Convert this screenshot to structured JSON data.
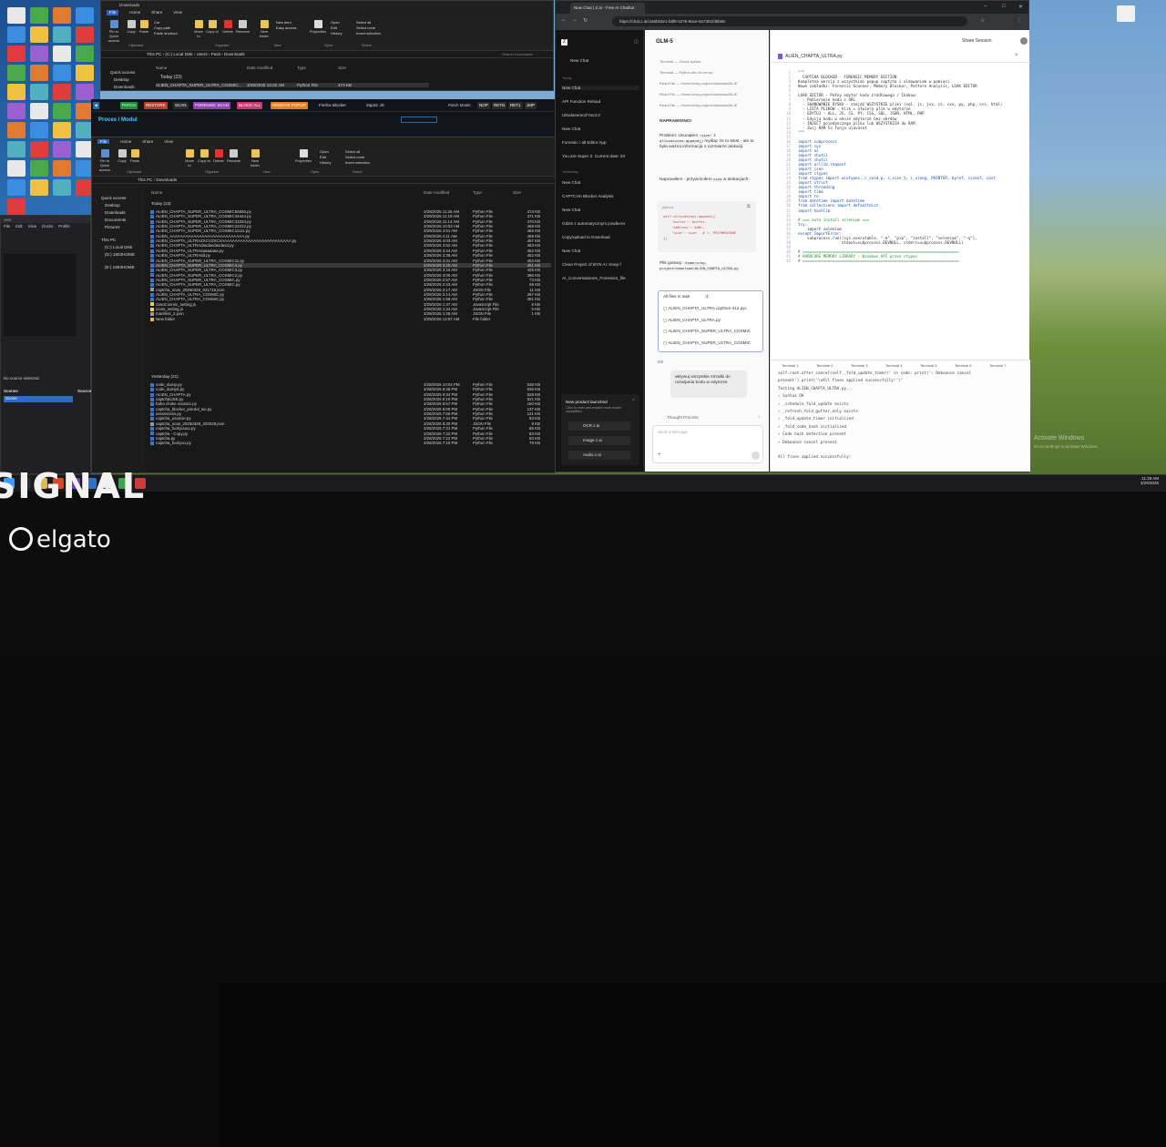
{
  "explorer_back": {
    "title": "Downloads",
    "tabs": [
      "File",
      "Home",
      "Share",
      "View"
    ],
    "ribbon": [
      "Pin to Quick access",
      "Copy",
      "Paste",
      "Cut",
      "Copy path",
      "Paste shortcut",
      "Move to",
      "Copy to",
      "Delete",
      "Rename",
      "New folder",
      "New item",
      "Easy access",
      "Properties",
      "Open",
      "Edit",
      "History",
      "Select all",
      "Select none",
      "Invert selection"
    ],
    "ribbon_groups": [
      "Clipboard",
      "Organize",
      "New",
      "Open",
      "Select"
    ],
    "path": "This PC › (C:) Local Disk › Users › Pasit › Downloads",
    "search": "Search Downloads",
    "columns": [
      "Name",
      "Date modified",
      "Type",
      "Size"
    ],
    "group": "Today (23)",
    "row1": {
      "name": "ALIEN_CHAPTA_SUPER_ULTRA_COSMIC...",
      "date": "3/29/2026 13:20 AM",
      "type": "Python File",
      "size": "473 KB"
    },
    "nav": [
      "Quick access",
      "Desktop",
      "Downloads"
    ]
  },
  "app_toolbar": {
    "buttons": [
      "PATCH",
      "RESTORE",
      "SCAN",
      "FORENSIC SCAN",
      "BLOCK ALL",
      "REMOVE POPUP"
    ],
    "extra": [
      "Firefox Blocker",
      "Zapisz JS"
    ],
    "patch_mode": "Patch Mode:",
    "modes": [
      "NOP",
      "RETN",
      "RET1",
      "JMP"
    ],
    "panel_title": "Proces / Modul"
  },
  "explorer_front": {
    "tabs": [
      "File",
      "Home",
      "Share",
      "View"
    ],
    "ribbon_groups": [
      "Clipboard",
      "Organize",
      "New",
      "Open",
      "Select"
    ],
    "path": "This PC › Downloads",
    "columns": [
      "Name",
      "Date modified",
      "Type",
      "Size"
    ],
    "group_today": "Today (23)",
    "group_yesterday": "Yesterday (21)",
    "nav": [
      "Quick access",
      "Desktop",
      "Downloads",
      "Documents",
      "Pictures",
      "This PC",
      "(C:) Local Disk",
      "(D:) 1803HOME",
      "(E:) 1903HOME"
    ],
    "today_files": [
      {
        "n": "ALIEN_CHAPTA_SUPER_ULTRA_COSMIC55555.py",
        "d": "3/29/2026 11:26 AM",
        "t": "Python File",
        "s": "474 KB"
      },
      {
        "n": "ALIEN_CHAPTA_SUPER_ULTRA_COSMIC44444.py",
        "d": "3/29/2026 11:19 AM",
        "t": "Python File",
        "s": "471 KB"
      },
      {
        "n": "ALIEN_CHAPTA_SUPER_ULTRA_COSMIC33333.py",
        "d": "3/29/2026 11:14 AM",
        "t": "Python File",
        "s": "470 KB"
      },
      {
        "n": "ALIEN_CHAPTA_SUPER_ULTRA_COSMIC22222.py",
        "d": "3/29/2026 10:53 AM",
        "t": "Python File",
        "s": "469 KB"
      },
      {
        "n": "ALIEN_CHAPTA_SUPER_ULTRA_COSMIC11111.py",
        "d": "3/29/2026 4:51 AM",
        "t": "Python File",
        "s": "465 KB"
      },
      {
        "n": "ALIEN_AAAAAAAAAAAAAAAAAAAAAAAAAAAA.py",
        "d": "3/29/2026 4:11 AM",
        "t": "Python File",
        "s": "459 KB"
      },
      {
        "n": "ALIEN_CHAPTA_ULTRAZXCVZXCVAAAAAAAAAAAAAAAAAAAAAAAAAA.py",
        "d": "3/29/2026 4:03 AM",
        "t": "Python File",
        "s": "457 KB"
      },
      {
        "n": "ALIEN_CHAPTA_ULTRAdasdasdasdasd.py",
        "d": "3/29/2026 3:52 AM",
        "t": "Python File",
        "s": "453 KB"
      },
      {
        "n": "ALIEN_CHAPTA_ULTRAaaaaaaaa.py",
        "d": "3/29/2026 3:44 AM",
        "t": "Python File",
        "s": "452 KB"
      },
      {
        "n": "ALIEN_CHAPTA_ULTRAdd.py",
        "d": "3/29/2026 3:38 AM",
        "t": "Python File",
        "s": "452 KB"
      },
      {
        "n": "ALIEN_CHAPTA_SUPER_ULTRA_COSMIC11.py",
        "d": "3/29/2026 3:31 AM",
        "t": "Python File",
        "s": "453 KB"
      },
      {
        "n": "ALIEN_CHAPTA_SUPER_ULTRA_COSMIC4.py",
        "d": "3/29/2026 3:25 AM",
        "t": "Python File",
        "s": "451 KB"
      },
      {
        "n": "ALIEN_CHAPTA_SUPER_ULTRA_COSMIC3.py",
        "d": "3/29/2026 3:16 AM",
        "t": "Python File",
        "s": "425 KB"
      },
      {
        "n": "ALIEN_CHAPTA_SUPER_ULTRA_COSMIC2.py",
        "d": "3/29/2026 3:08 AM",
        "t": "Python File",
        "s": "396 KB"
      },
      {
        "n": "ALIEN_CHAPTA_SUPER_ULTRA_COSMIC.py",
        "d": "3/29/2026 2:57 AM",
        "t": "Python File",
        "s": "73 KB"
      },
      {
        "n": "ALIEN_CHAPTA_SUPER_ULTRA_COSMIC.py",
        "d": "3/29/2026 2:43 AM",
        "t": "Python File",
        "s": "69 KB"
      },
      {
        "n": "captcha_scan_20260329_021715.json",
        "d": "3/29/2026 2:17 AM",
        "t": "JSON File",
        "s": "11 KB"
      },
      {
        "n": "ALIEN_CHAPTA_ULTRA_COSMIC.py",
        "d": "3/29/2026 2:14 AM",
        "t": "Python File",
        "s": "287 KB"
      },
      {
        "n": "ALIEN_CHAPTA_ULTRA_COSMIC.py",
        "d": "3/29/2026 1:58 AM",
        "t": "Python File",
        "s": "281 KB"
      },
      {
        "n": "zanoCosmic_setting.js",
        "d": "3/29/2026 1:37 AM",
        "t": "JavaScript File",
        "s": "6 KB"
      },
      {
        "n": "icons_setting.js",
        "d": "3/29/2026 1:34 AM",
        "t": "JavaScript File",
        "s": "5 KB"
      },
      {
        "n": "manifest_2.json",
        "d": "3/29/2026 1:28 AM",
        "t": "JSON File",
        "s": "1 KB"
      },
      {
        "n": "New folder",
        "d": "3/29/2026 12:57 AM",
        "t": "File folder",
        "s": ""
      }
    ],
    "yesterday_files": [
      {
        "n": "code_dump.py",
        "d": "3/28/2026 10:04 PM",
        "t": "Python File",
        "s": "538 KB"
      },
      {
        "n": "code_dump2.py",
        "d": "3/28/2026 9:48 PM",
        "t": "Python File",
        "s": "536 KB"
      },
      {
        "n": "ALIEN_CHAPTA.py",
        "d": "3/28/2026 9:34 PM",
        "t": "Python File",
        "s": "528 KB"
      },
      {
        "n": "captchaUSE.py",
        "d": "3/28/2026 9:19 PM",
        "t": "Python File",
        "s": "521 KB"
      },
      {
        "n": "haha choke usuniec.py",
        "d": "3/28/2026 8:57 PM",
        "t": "Python File",
        "s": "160 KB"
      },
      {
        "n": "captcha_blocker_pierdol_sie.py",
        "d": "3/28/2026 8:09 PM",
        "t": "Python File",
        "s": "137 KB"
      },
      {
        "n": "asssssssss.py",
        "d": "3/28/2026 7:58 PM",
        "t": "Python File",
        "s": "121 KB"
      },
      {
        "n": "captcha_ususcie.py",
        "d": "3/28/2026 7:44 PM",
        "t": "Python File",
        "s": "93 KB"
      },
      {
        "n": "captcha_scan_20260328_203028.json",
        "d": "3/28/2026 8:30 PM",
        "t": "JSON File",
        "s": "9 KB"
      },
      {
        "n": "captcha_fuckyouuu.py",
        "d": "3/28/2026 7:31 PM",
        "t": "Python File",
        "s": "85 KB"
      },
      {
        "n": "captcha - Copy.py",
        "d": "3/28/2026 7:22 PM",
        "t": "Python File",
        "s": "83 KB"
      },
      {
        "n": "captcha.py",
        "d": "3/28/2026 7:22 PM",
        "t": "Python File",
        "s": "83 KB"
      },
      {
        "n": "captcha_fuckyou.py",
        "d": "3/28/2026 7:18 PM",
        "t": "Python File",
        "s": "79 KB"
      }
    ]
  },
  "browser": {
    "tab": "New Chat | Z.ai - Free AI Chatbot",
    "url": "https://chat.z.ai/c/a6b53e1-b8f8-4276-9ace-6a7351bf8b65",
    "sidebar": {
      "new_chat": "New Chat",
      "today": "Today",
      "today_items": [
        "New Chat",
        "API Function Reload",
        "Ultralaserocd'Yov3.0",
        "New Chat",
        "Forensic / all Editor App",
        "You are Super Z. Current date: 20"
      ],
      "yesterday": "Yesterday",
      "yesterday_items": [
        "New Chat",
        "CAPTCHA Blocker Analysis",
        "New Chat",
        "Gdzie z automatycznym powbiera",
        "Copy/upload to Download",
        "New Chat",
        "Clean Project of BYN AI: Keep f",
        "AI_Conversationes_Forensics_file"
      ],
      "promo_title": "New product launched",
      "promo_text": "Click to enter and explore more model capabilities",
      "promo_items": [
        "OCR.z.ai",
        "Image.z.ai",
        "Audio.z.ai"
      ]
    },
    "chat": {
      "model": "GLM-5",
      "tools": [
        "Terminal — Check syntax",
        "Terminal — Python dev kit errors",
        "Read File — /home/z/my-project/download/ALIE",
        "Read File — /home/z/my-project/download/ALIE",
        "Read File — /home/z/my-project/download/ALIE"
      ],
      "fixed": "NAPRAWIONO!",
      "problem_1": "Problem: Usunąłem",
      "code_size": "'size'",
      "problem_2": "z",
      "code_alloc": "allocations.append()",
      "problem_3": "myśląc że to tekst - ale to była ważna informacja o rozmiarze alokacji.",
      "restored_1": "Naprawiłem - przywróciłem",
      "code_size2": "size",
      "restored_2": "w alokacjach:",
      "code_lang": "python",
      "code_lines": [
        "self.allocations.append({",
        "    'buffer': buffer,",
        "    'address': addr,",
        "    'size': size   # <- PRZYWRÓCONE",
        "})"
      ],
      "ready_1": "Plik gotowy:",
      "ready_path": "/home/z/my-project/download/ALIEN_CHAPTA_ULTRA.py",
      "files_label": "All files in task",
      "files_count": "4",
      "files": [
        "ALIEN_CHAPTA_ULTRA.cpython-312.pyc",
        "ALIEN_CHAPTA_ULTRA.py",
        "ALIEN_CHAPTA_SUPER_ULTRA_COSMIC",
        "ALIEN_CHAPTA_SUPER_ULTRA_COSMIC"
      ],
      "pager": "8/8",
      "user_msg": "aktywuj wszystkie strzałki do rozwijania kodu w edytorze",
      "thought": "Thought Process",
      "input_placeholder": "Send a Message"
    },
    "editor": {
      "share": "Share Session",
      "filename": "ALIEN_CHAPTA_ULTRA.py",
      "code": [
        "\"\"\"",
        "  CAPTCHA BLOCKER - FORENSIC MEMORY EDITION",
        "Kompletna wersja z wszystkimi popup captcha i oldowaniem w pamięci",
        "Nowe zakładki: Forensic Scanner, Memory Blocker, Pattern Analysis, LOAK EDITOR",
        "",
        "LOAK EDITOR - Pełny edytor kodu źródłowego / Ikakow:",
        "  - Pobieranie kodu z URL",
        "  - SKANOWANIE DYSKU - znajdź WSZYSTKIE pliki (sql, js, jsx, cs, cxx, py, php, css, html)",
        "  - LISTA PLIKÓW - klik = otwiera plik w edytorze",
        "  - EDYTUJ - ALL, JS, CS, PY, CSS, SQL, JSON, HTML, PHP",
        "  - Edycja kodu w oknie edytorze bez okrdów",
        "  - INJECT pojedynczego pliku lub WSZYSTKICH do RAM",
        "  - Zwij RAM to funja ulavasot",
        "\"\"\"",
        "",
        "import subprocess",
        "import sys",
        "import os",
        "import shutil",
        "import shutil",
        "import urllib.request",
        "import json",
        "import ctypes",
        "from ctypes import wintypes, c_void_p, c_size_t, c_ulong, POINTER, byref, sizeof, cast",
        "import struct",
        "import threading",
        "import time",
        "import re",
        "from datetime import datetime",
        "from collections import defaultdict",
        "import hashlib",
        "",
        "# === auto install selenium ===",
        "try:",
        "    import selenium",
        "except ImportError:",
        "    subprocess.run([sys.executable, \"-m\", \"pip\", \"install\", \"selenium\", \"-q\"],",
        "                   stdout=subprocess.DEVNULL, stderr=subprocess.DEVNULL)",
        "",
        "# ====================================================================",
        "# HARDCORE MEMORY LIBRARY - Windows API przez ctypes",
        "# ===================================================================="
      ],
      "term_tabs": [
        "Terminal 1",
        "Terminal 2",
        "Terminal 3",
        "Terminal 4",
        "Terminal 5",
        "Terminal 6",
        "Terminal 7"
      ],
      "term": [
        "self.root.after_cancel(self._fold_update_timer)' in code: print('✓ Debounce cancel",
        "present') print('\\nAll fixes applied successfully!')\"",
        "Testing ALIEN_CHAPTA_ULTRA.py...",
        "✓ Syntax OK",
        "✓ _schedule_fold_update exists",
        "✓ _refresh_fold_gutter_only exists",
        "✓ _fold_update_timer initialized",
        "✓ _fold_code_hash initialized",
        "✓ Code hash detection present",
        "✓ Debounce cancel present",
        "",
        "All fixes applied successfully!"
      ]
    }
  },
  "obs": {
    "menu": [
      "File",
      "Edit",
      "View",
      "Docks",
      "Profile"
    ],
    "no_source": "No source selected",
    "scenes": "Scenes",
    "scene": "Scene",
    "sources": "Sources"
  },
  "overlay": {
    "signal": "SIGNAL",
    "brand": "elgato"
  },
  "watermark": {
    "line1": "Activate Windows",
    "line2": "Go to Settings to activate Windows."
  },
  "clock": {
    "time": "11:28 AM",
    "date": "3/29/2026"
  }
}
